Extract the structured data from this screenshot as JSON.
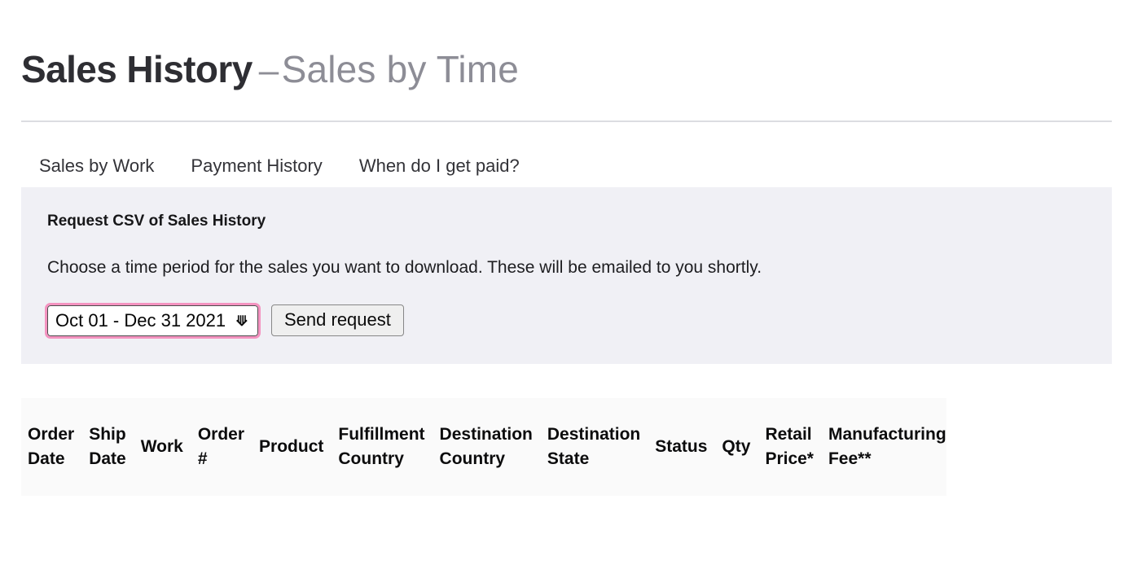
{
  "header": {
    "title_main": "Sales History",
    "title_separator": "–",
    "title_sub": "Sales by Time"
  },
  "tabs": [
    {
      "label": "Sales by Work"
    },
    {
      "label": "Payment History"
    },
    {
      "label": "When do I get paid?"
    }
  ],
  "csv_panel": {
    "heading": "Request CSV of Sales History",
    "description": "Choose a time period for the sales you want to download. These will be emailed to you shortly.",
    "period_select": {
      "selected": "Oct 01 - Dec 31 2021",
      "options": [
        "Oct 01 - Dec 31 2021"
      ],
      "chevron_icon": "chevron-down-icon",
      "focus_ring_color": "#f493c0"
    },
    "send_button_label": "Send request",
    "background_color": "#f0f0f5"
  },
  "table": {
    "columns": [
      "Order Date",
      "Ship Date",
      "Work",
      "Order #",
      "Product",
      "Fulfillment Country",
      "Destination Country",
      "Destination State",
      "Status",
      "Qty",
      "Retail Price*",
      "Manufacturing Fee**"
    ],
    "rows": [],
    "header_background": "#fafafa"
  }
}
